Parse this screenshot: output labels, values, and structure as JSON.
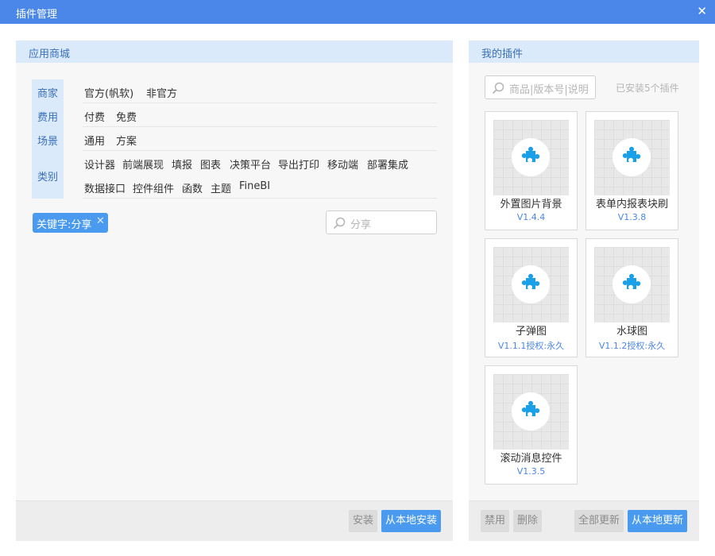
{
  "window": {
    "title": "插件管理",
    "close_glyph": "✕"
  },
  "store": {
    "header": "应用商城",
    "filters": [
      {
        "label": "商家",
        "options": [
          "官方(帆软)",
          "非官方"
        ]
      },
      {
        "label": "费用",
        "options": [
          "付费",
          "免费"
        ]
      },
      {
        "label": "场景",
        "options": [
          "通用",
          "方案"
        ]
      },
      {
        "label": "类别",
        "options": [
          "设计器",
          "前端展现",
          "填报",
          "图表",
          "决策平台",
          "导出打印",
          "移动端",
          "部署集成",
          "数据接口",
          "控件组件",
          "函数",
          "主题",
          "FineBI"
        ]
      }
    ],
    "keyword_tag": {
      "label": "关键字:分享",
      "remove_glyph": "✕"
    },
    "search": {
      "value": "分享",
      "icon": "search-icon"
    },
    "buttons": {
      "install": "安装",
      "install_local": "从本地安装"
    }
  },
  "mine": {
    "header": "我的插件",
    "search": {
      "placeholder": "商品|版本号|说明",
      "icon": "search-icon"
    },
    "installed_count": "已安装5个插件",
    "plugins": [
      {
        "name": "外置图片背景",
        "version": "V1.4.4",
        "icon": "puzzle-icon"
      },
      {
        "name": "表单内报表块刷",
        "version": "V1.3.8",
        "icon": "puzzle-icon"
      },
      {
        "name": "子弹图",
        "version": "V1.1.1授权:永久",
        "icon": "puzzle-icon"
      },
      {
        "name": "水球图",
        "version": "V1.1.2授权:永久",
        "icon": "puzzle-icon"
      },
      {
        "name": "滚动消息控件",
        "version": "V1.3.5",
        "icon": "puzzle-icon"
      }
    ],
    "buttons": {
      "disable": "禁用",
      "delete": "删除",
      "update_all": "全部更新",
      "update_local": "从本地更新"
    }
  },
  "colors": {
    "accent": "#4a87e8",
    "button_blue": "#4a9bf0",
    "header_bg": "#dbeafb",
    "puzzle": "#1aa0e8"
  }
}
